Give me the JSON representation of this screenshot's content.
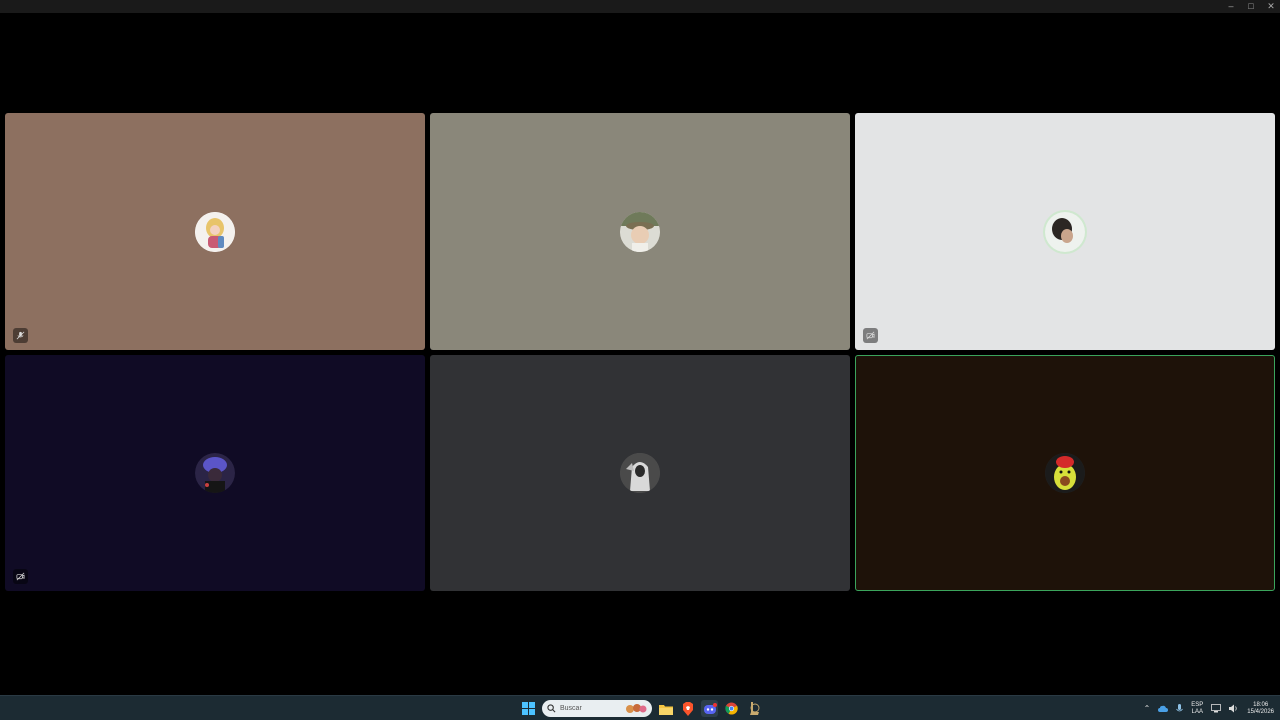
{
  "window": {
    "controls": [
      "minimize",
      "maximize",
      "close"
    ]
  },
  "tiles": [
    {
      "id": "tile-1",
      "bg": "#8d7060",
      "status": "mic-muted",
      "speaking": false,
      "avatar": "avatar-anime-blonde"
    },
    {
      "id": "tile-2",
      "bg": "#8a877a",
      "status": "",
      "speaking": false,
      "avatar": "avatar-man-hat"
    },
    {
      "id": "tile-3",
      "bg": "#e3e4e5",
      "status": "camera-off",
      "speaking": false,
      "avatar": "avatar-dark-hair"
    },
    {
      "id": "tile-4",
      "bg": "#100b25",
      "status": "camera-off",
      "speaking": false,
      "avatar": "avatar-blue-hands"
    },
    {
      "id": "tile-5",
      "bg": "#313235",
      "status": "",
      "speaking": false,
      "avatar": "avatar-ghost"
    },
    {
      "id": "tile-6",
      "bg": "#1e1209",
      "status": "",
      "speaking": true,
      "avatar": "avatar-avocado"
    }
  ],
  "taskbar": {
    "search_placeholder": "Buscar",
    "lang_line1": "ESP",
    "lang_line2": "LAA",
    "time": "18:06",
    "date": "15/4/2026",
    "apps": [
      "start-icon",
      "file-explorer-icon",
      "brave-browser-icon",
      "discord-icon",
      "chrome-icon",
      "league-client-icon"
    ]
  },
  "colors": {
    "speaking_border": "#3ba55c",
    "taskbar_bg": "#1c2b33"
  }
}
